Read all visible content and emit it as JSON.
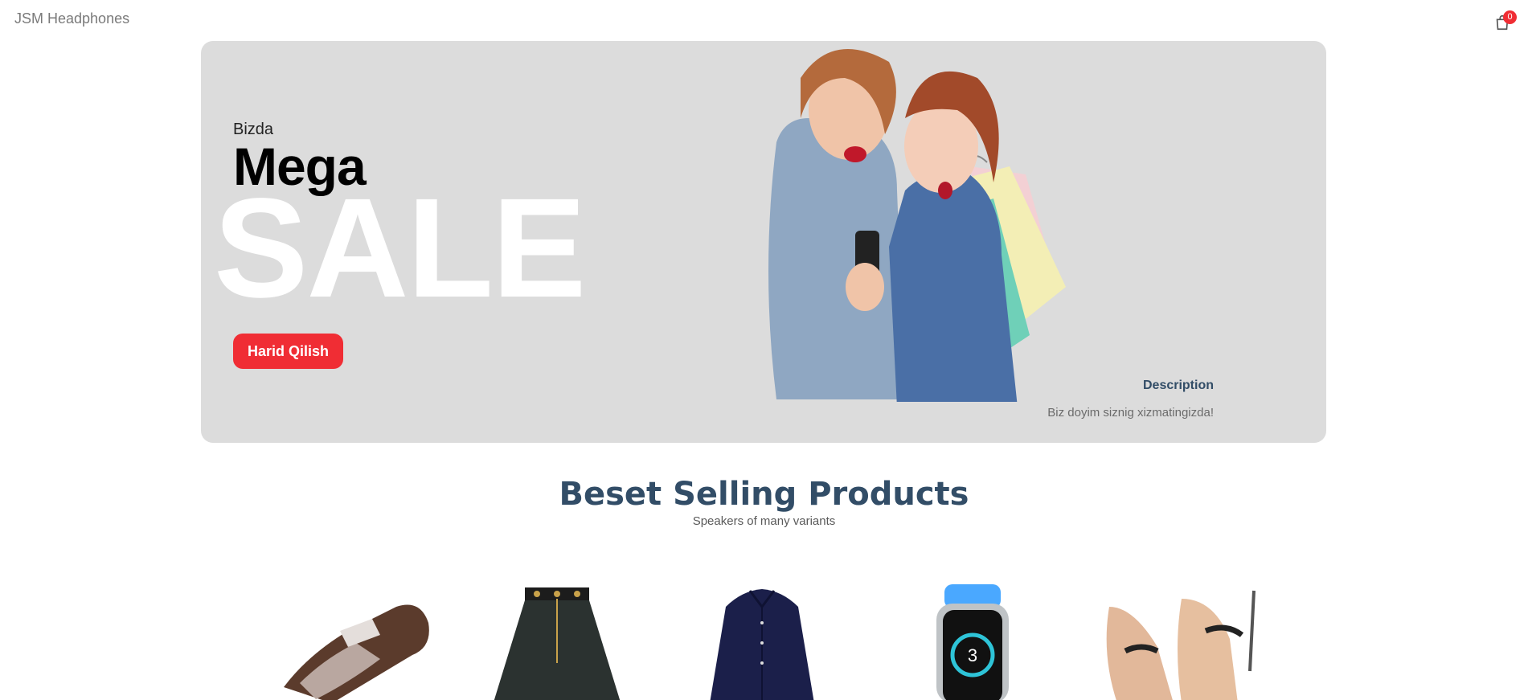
{
  "navbar": {
    "logo": "JSM Headphones",
    "cart_count": "0",
    "cart_icon": "shopping-bag-icon"
  },
  "hero": {
    "small_text": "Bizda",
    "mid_text": "Mega",
    "large_text": "SALE",
    "button_label": "Harid Qilish",
    "image": "two-women-with-shopping-bags",
    "description_title": "Description",
    "description_text": "Biz doyim siznig xizmatingizda!"
  },
  "products_heading": {
    "title": "Beset Selling Products",
    "subtitle": "Speakers of many variants"
  },
  "products": [
    {
      "image": "leather-shoe"
    },
    {
      "image": "black-skirt"
    },
    {
      "image": "navy-shirt"
    },
    {
      "image": "smart-watch"
    },
    {
      "image": "high-heels"
    }
  ],
  "colors": {
    "accent": "#f02d34",
    "heading": "#324d67",
    "banner_bg": "#dcdcdc"
  }
}
